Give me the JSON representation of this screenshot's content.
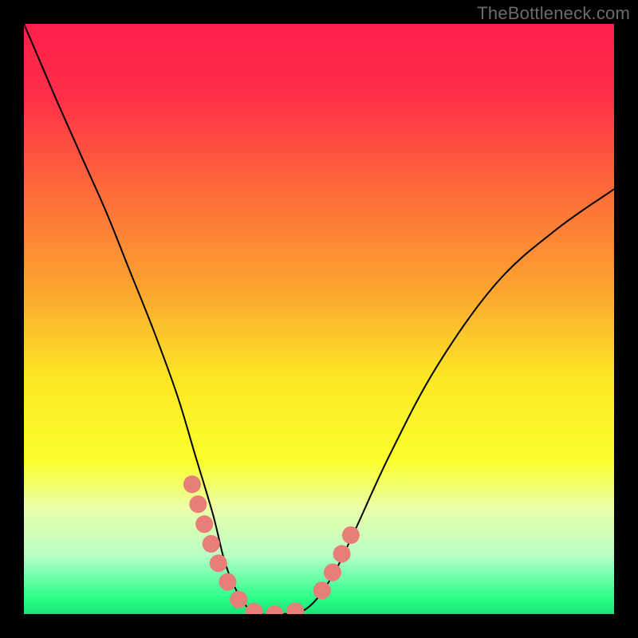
{
  "watermark": "TheBottleneck.com",
  "plot": {
    "x_range": [
      0,
      100
    ],
    "y_range": [
      0,
      100
    ],
    "gradient_stops": [
      {
        "pct": 0,
        "color": "#ff1f4b"
      },
      {
        "pct": 12,
        "color": "#ff2e49"
      },
      {
        "pct": 28,
        "color": "#fe6a3a"
      },
      {
        "pct": 45,
        "color": "#fca42f"
      },
      {
        "pct": 60,
        "color": "#fde726"
      },
      {
        "pct": 74,
        "color": "#fbff2b"
      },
      {
        "pct": 82,
        "color": "#ecffa9"
      },
      {
        "pct": 90,
        "color": "#b9ffc4"
      },
      {
        "pct": 93,
        "color": "#7dffb1"
      },
      {
        "pct": 97,
        "color": "#2fff8a"
      },
      {
        "pct": 100,
        "color": "#17e676"
      }
    ]
  },
  "chart_data": {
    "type": "line",
    "title": "",
    "xlabel": "",
    "ylabel": "",
    "xlim": [
      0,
      100
    ],
    "ylim": [
      0,
      100
    ],
    "series": [
      {
        "name": "bottleneck-curve",
        "color": "#000000",
        "x": [
          0,
          3,
          6,
          10,
          14,
          18,
          22,
          26,
          29,
          32,
          34,
          36,
          38,
          40,
          44,
          48,
          52,
          56,
          62,
          70,
          80,
          90,
          100
        ],
        "y": [
          100,
          93,
          86,
          77,
          68,
          58,
          48,
          37,
          27,
          17,
          9,
          4,
          1,
          0,
          0,
          1,
          6,
          14,
          27,
          42,
          56,
          65,
          72
        ]
      },
      {
        "name": "highlight-left",
        "color": "#e77e78",
        "x": [
          28.5,
          30.0,
          31.5,
          33.0,
          34.5,
          36.0,
          37.5,
          39.0
        ],
        "y": [
          22.0,
          17.0,
          12.5,
          8.5,
          5.5,
          3.0,
          1.3,
          0.4
        ]
      },
      {
        "name": "highlight-bottom",
        "color": "#e77e78",
        "x": [
          39.0,
          41.0,
          43.0,
          45.0,
          47.0
        ],
        "y": [
          0.4,
          0.0,
          0.0,
          0.2,
          0.8
        ]
      },
      {
        "name": "highlight-right",
        "color": "#e77e78",
        "x": [
          50.5,
          52.0,
          53.5,
          55.0,
          56.5
        ],
        "y": [
          4.0,
          6.5,
          9.5,
          12.5,
          16.0
        ]
      }
    ]
  }
}
